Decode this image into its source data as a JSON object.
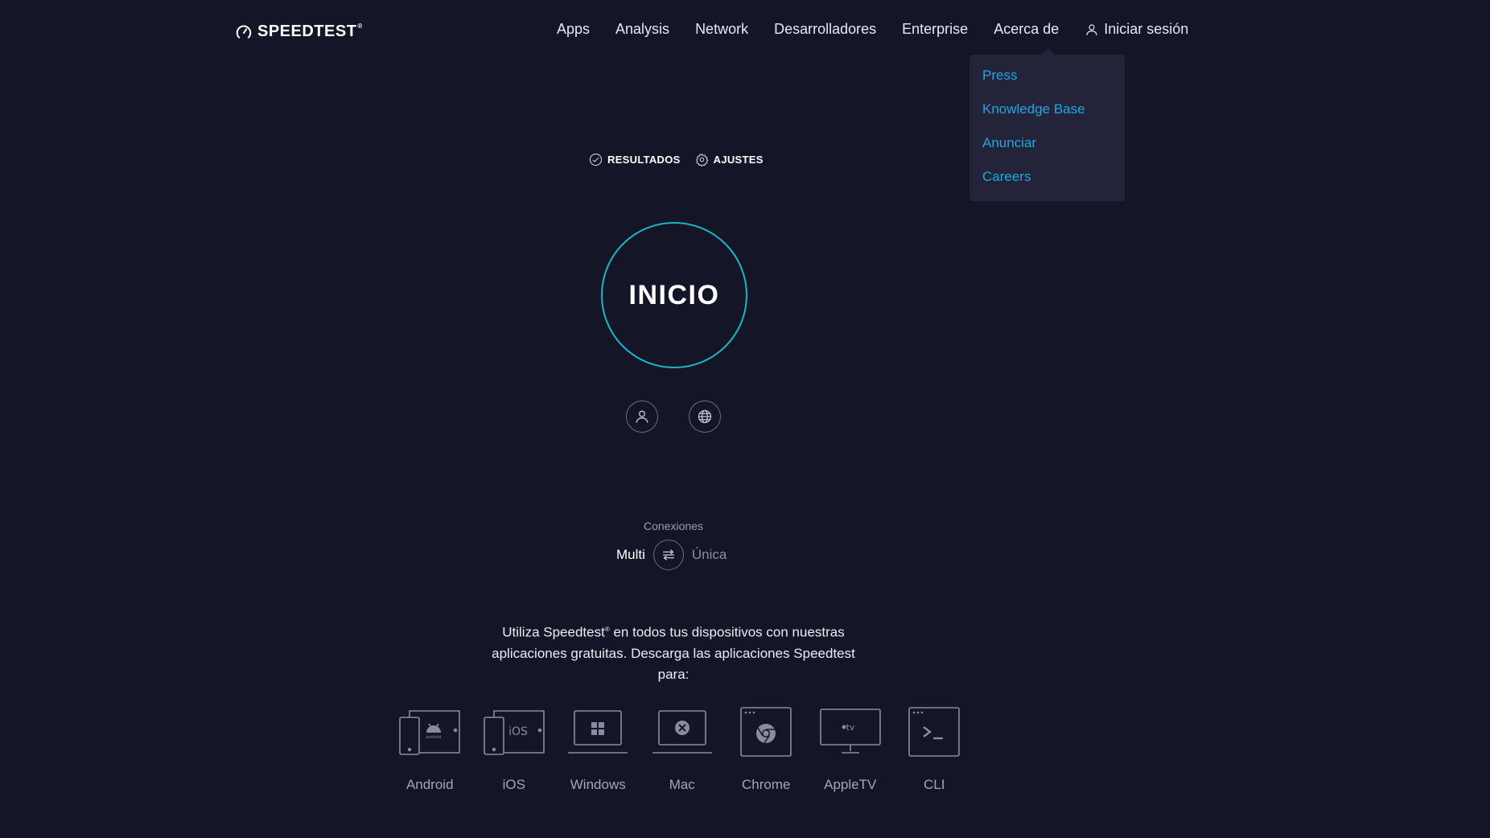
{
  "header": {
    "logo_text": "SPEEDTEST",
    "logo_reg": "®",
    "nav": [
      {
        "label": "Apps"
      },
      {
        "label": "Analysis"
      },
      {
        "label": "Network"
      },
      {
        "label": "Desarrolladores"
      },
      {
        "label": "Enterprise"
      },
      {
        "label": "Acerca de"
      }
    ],
    "login_label": "Iniciar sesión"
  },
  "dropdown": {
    "items": [
      {
        "label": "Press"
      },
      {
        "label": "Knowledge Base"
      },
      {
        "label": "Anunciar"
      },
      {
        "label": "Careers"
      }
    ]
  },
  "tools": {
    "results_label": "RESULTADOS",
    "settings_label": "AJUSTES"
  },
  "start_button": {
    "label": "INICIO"
  },
  "connections": {
    "label": "Conexiones",
    "multi": "Multi",
    "single": "Única"
  },
  "apps_text": {
    "line1_prefix": "Utiliza Speedtest",
    "line1_sup": "®",
    "line1_suffix": " en todos tus dispositivos con nuestras",
    "line2": "aplicaciones gratuitas. Descarga las aplicaciones Speedtest",
    "line3": "para:"
  },
  "apps": [
    {
      "label": "Android",
      "icon": "android-device-icon"
    },
    {
      "label": "iOS",
      "icon": "ios-device-icon"
    },
    {
      "label": "Windows",
      "icon": "windows-laptop-icon"
    },
    {
      "label": "Mac",
      "icon": "mac-laptop-icon"
    },
    {
      "label": "Chrome",
      "icon": "chrome-browser-icon"
    },
    {
      "label": "AppleTV",
      "icon": "appletv-icon"
    },
    {
      "label": "CLI",
      "icon": "terminal-icon"
    }
  ],
  "colors": {
    "background": "#141526",
    "accent_ring": "#1eb4c8",
    "dropdown_link": "#1fa7e0",
    "dropdown_bg": "#23243a"
  }
}
